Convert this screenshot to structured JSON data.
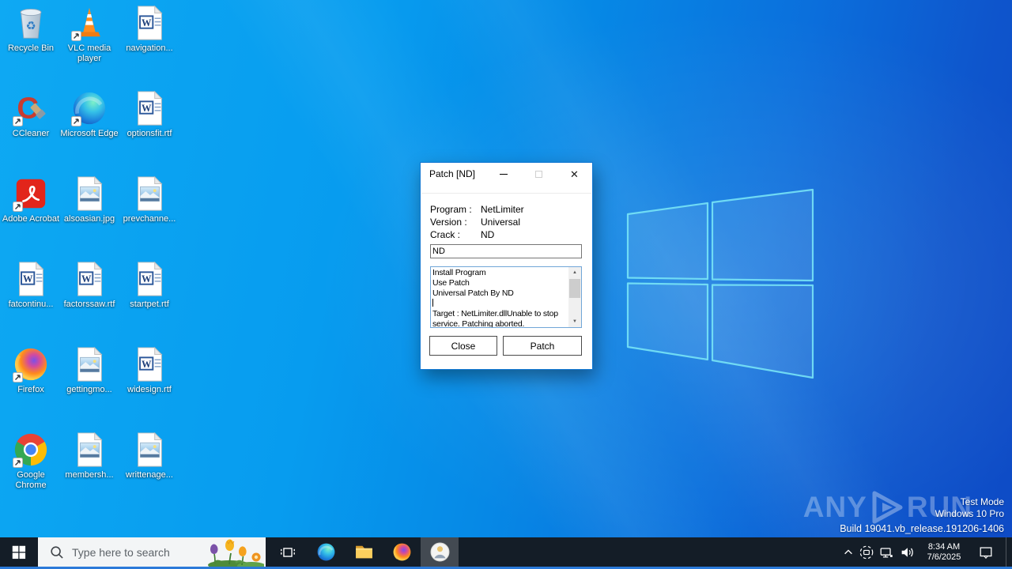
{
  "desktop": {
    "icons": [
      {
        "label": "Recycle Bin",
        "type": "recycle-bin"
      },
      {
        "label": "VLC media player",
        "type": "vlc"
      },
      {
        "label": "navigation...",
        "type": "word"
      },
      {
        "label": "CCleaner",
        "type": "ccleaner"
      },
      {
        "label": "Microsoft Edge",
        "type": "edge"
      },
      {
        "label": "optionsfit.rtf",
        "type": "word"
      },
      {
        "label": "Adobe Acrobat",
        "type": "acrobat"
      },
      {
        "label": "alsoasian.jpg",
        "type": "image"
      },
      {
        "label": "prevchanne...",
        "type": "image"
      },
      {
        "label": "fatcontinu...",
        "type": "word"
      },
      {
        "label": "factorssaw.rtf",
        "type": "word"
      },
      {
        "label": "startpet.rtf",
        "type": "word"
      },
      {
        "label": "Firefox",
        "type": "firefox"
      },
      {
        "label": "gettingmo...",
        "type": "image"
      },
      {
        "label": "widesign.rtf",
        "type": "word"
      },
      {
        "label": "Google Chrome",
        "type": "chrome"
      },
      {
        "label": "membersh...",
        "type": "image"
      },
      {
        "label": "writtenage...",
        "type": "image"
      }
    ]
  },
  "dialog": {
    "title": "Patch [ND]",
    "fields": [
      {
        "label": "Program :",
        "value": "NetLimiter"
      },
      {
        "label": "Version :",
        "value": "Universal"
      },
      {
        "label": "Crack :",
        "value": "ND"
      }
    ],
    "input_value": "ND",
    "log_lines": [
      "Install Program",
      "Use Patch",
      "Universal Patch By ND",
      "",
      "Target : NetLimiter.dllUnable to stop",
      "service. Patching aborted."
    ],
    "buttons": {
      "close": "Close",
      "patch": "Patch"
    }
  },
  "taskbar": {
    "search_placeholder": "Type here to search",
    "clock": {
      "time": "8:34 AM",
      "date": "7/6/2025"
    }
  },
  "watermark": {
    "brand_left": "ANY",
    "brand_right": "RUN",
    "lines": [
      "Test Mode",
      "Windows 10 Pro",
      "Build 19041.vb_release.191206-1406"
    ]
  },
  "colors": {
    "accent": "#0078d7",
    "taskbar_bg": "#141d27",
    "wallpaper_top_left": "#0ea9f3",
    "wallpaper_bottom_right": "#0e4ac5",
    "bottom_strip": "#2b7ad9"
  }
}
